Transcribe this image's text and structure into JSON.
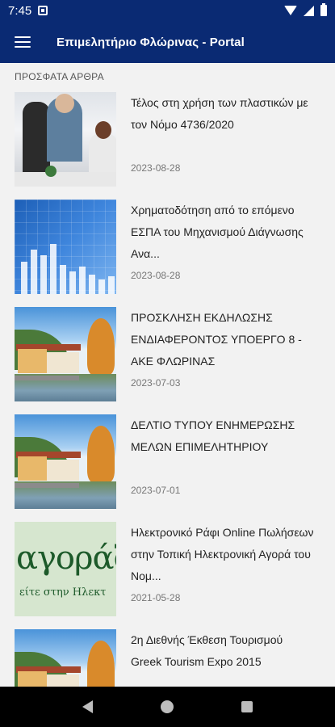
{
  "status_bar": {
    "time": "7:45",
    "icons": [
      "notification-icon",
      "wifi-icon",
      "signal-icon",
      "battery-icon"
    ]
  },
  "app_bar": {
    "title": "Επιμελητήριο Φλώρινας - Portal",
    "background": "#0a2a73",
    "menu_icon": "hamburger-menu-icon"
  },
  "section": {
    "header": "ΠΡΟΣΦΑΤΑ ΑΡΘΡΑ"
  },
  "articles": [
    {
      "title": "Τέλος στη χρήση των πλαστικών με τον Νόμο 4736/2020",
      "date": "2023-08-28",
      "thumbnail": "office-meeting"
    },
    {
      "title": "Χρηματοδότηση από το επόμενο ΕΣΠΑ του Μηχανισμού Διάγνωσης Ανα...",
      "date": "2023-08-28",
      "thumbnail": "finance-chart"
    },
    {
      "title": "ΠΡΟΣΚΛΗΣΗ ΕΚΔΗΛΩΣΗΣ ΕΝΔΙΑΦΕΡΟΝΤΟΣ ΥΠΟΕΡΓΟ 8 - ΑΚΕ ΦΛΩΡΙΝΑΣ",
      "date": "2023-07-03",
      "thumbnail": "florina-town"
    },
    {
      "title": "ΔΕΛΤΙΟ ΤΥΠΟΥ ΕΝΗΜΕΡΩΣΗΣ ΜΕΛΩΝ ΕΠΙΜΕΛΗΤΗΡΙΟΥ",
      "date": "2023-07-01",
      "thumbnail": "florina-town"
    },
    {
      "title": "Ηλεκτρονικό Ράφι Online Πωλήσεων στην Τοπική Ηλεκτρονική Αγορά του Νομ...",
      "date": "2021-05-28",
      "thumbnail": "agora-logo",
      "thumb_text": "αγοράζω",
      "thumb_subtext": "είτε στην Ηλεκτ"
    },
    {
      "title": "2η Διεθνής Έκθεση Τουρισμού Greek Tourism Expo 2015",
      "date": "",
      "thumbnail": "florina-town"
    }
  ],
  "nav_bar": {
    "buttons": [
      "back-icon",
      "home-icon",
      "recents-icon"
    ]
  }
}
